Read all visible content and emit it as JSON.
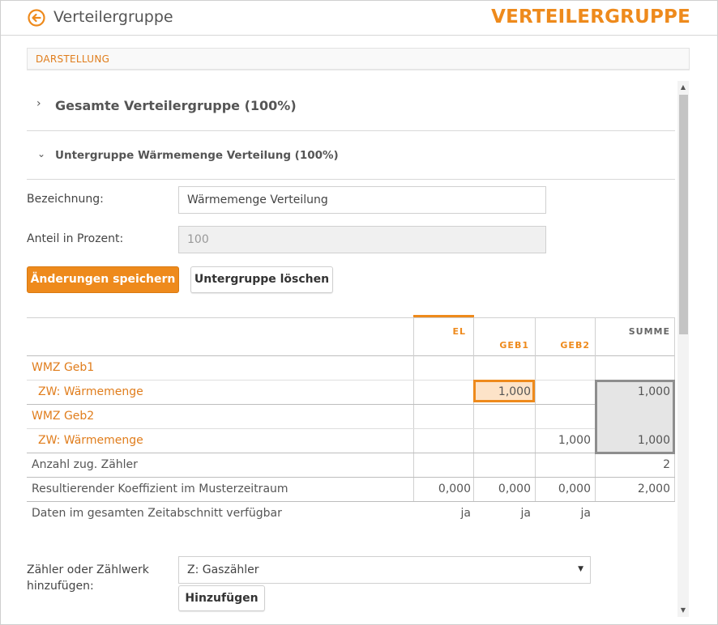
{
  "header": {
    "title": "Verteilergruppe",
    "brand": "VERTEILERGRUPPE"
  },
  "section": {
    "label": "DARSTELLUNG"
  },
  "accordion": {
    "group": {
      "label": "Gesamte Verteilergruppe (100%)"
    },
    "subgroup": {
      "label": "Untergruppe Wärmemenge Verteilung (100%)"
    }
  },
  "form": {
    "name_label": "Bezeichnung:",
    "name_value": "Wärmemenge Verteilung",
    "percent_label": "Anteil in Prozent:",
    "percent_value": "100",
    "save_label": "Änderungen speichern",
    "delete_label": "Untergruppe löschen"
  },
  "table": {
    "columns": [
      "EL",
      "GEB1",
      "GEB2",
      "SUMME"
    ],
    "rows": [
      {
        "label": "WMZ Geb1",
        "el": "",
        "geb1": "",
        "geb2": "",
        "summe": ""
      },
      {
        "label": "ZW: Wärmemenge",
        "el": "",
        "geb1": "1,000",
        "geb2": "",
        "summe": "1,000"
      },
      {
        "label": "WMZ Geb2",
        "el": "",
        "geb1": "",
        "geb2": "",
        "summe": ""
      },
      {
        "label": "ZW: Wärmemenge",
        "el": "",
        "geb1": "",
        "geb2": "1,000",
        "summe": "1,000"
      },
      {
        "label": "Anzahl zug. Zähler",
        "el": "",
        "geb1": "",
        "geb2": "",
        "summe": "2"
      },
      {
        "label": "Resultierender Koeffizient im Musterzeitraum",
        "el": "0,000",
        "geb1": "0,000",
        "geb2": "0,000",
        "summe": "2,000"
      },
      {
        "label": "Daten im gesamten Zeitabschnitt verfügbar",
        "el": "ja",
        "geb1": "ja",
        "geb2": "ja",
        "summe": ""
      }
    ]
  },
  "add": {
    "label_line1": "Zähler oder Zählwerk",
    "label_line2": "hinzufügen:",
    "select_value": "Z: Gaszähler",
    "button_label": "Hinzufügen"
  },
  "colors": {
    "accent": "#ee8a1c",
    "highlight_fill": "#fde3c8",
    "summe_fill": "#e5e5e5"
  }
}
